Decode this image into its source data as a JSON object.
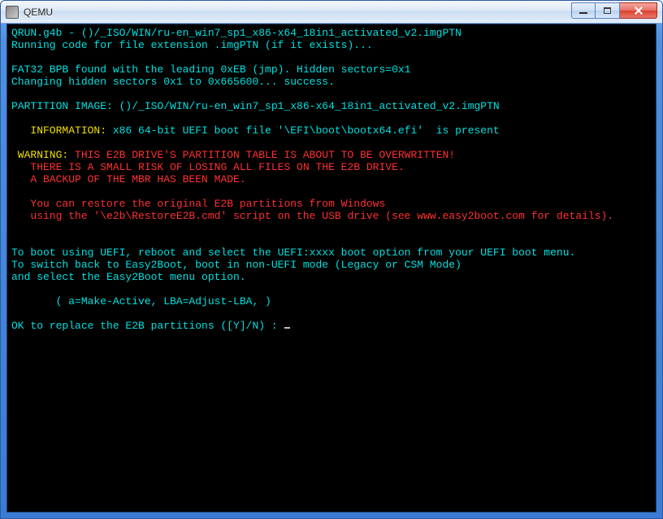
{
  "window": {
    "title": "QEMU"
  },
  "term": {
    "l01": "QRUN.g4b - ()/_ISO/WIN/ru-en_win7_sp1_x86-x64_18in1_activated_v2.imgPTN",
    "l02": "Running code for file extension .imgPTN (if it exists)...",
    "l03": "",
    "l04": "FAT32 BPB found with the leading 0xEB (jmp). Hidden sectors=0x1",
    "l05": "Changing hidden sectors 0x1 to 0x665600... success.",
    "l06": "",
    "l07": "PARTITION IMAGE: ()/_ISO/WIN/ru-en_win7_sp1_x86-x64_18in1_activated_v2.imgPTN",
    "l08": "",
    "info_label": "   INFORMATION:",
    "info_text": " x86 64-bit UEFI boot file '\\EFI\\boot\\bootx64.efi'  is present",
    "l10": "",
    "warn_label": " WARNING:",
    "warn1": " THIS E2B DRIVE'S PARTITION TABLE IS ABOUT TO BE OVERWRITTEN!",
    "warn2": "   THERE IS A SMALL RISK OF LOSING ALL FILES ON THE E2B DRIVE.",
    "warn3": "   A BACKUP OF THE MBR HAS BEEN MADE.",
    "warn4": "",
    "warn5": "   You can restore the original E2B partitions from Windows",
    "warn6": "   using the '\\e2b\\RestoreE2B.cmd' script on the USB drive (see www.easy2boot.com for details).",
    "l18": "",
    "l19": "",
    "l20": "To boot using UEFI, reboot and select the UEFI:xxxx boot option from your UEFI boot menu.",
    "l21": "To switch back to Easy2Boot, boot in non-UEFI mode (Legacy or CSM Mode)",
    "l22": "and select the Easy2Boot menu option.",
    "l23": "",
    "l24": "       ( a=Make-Active, LBA=Adjust-LBA, )",
    "l25": "",
    "prompt": "OK to replace the E2B partitions ([Y]/N) : "
  }
}
